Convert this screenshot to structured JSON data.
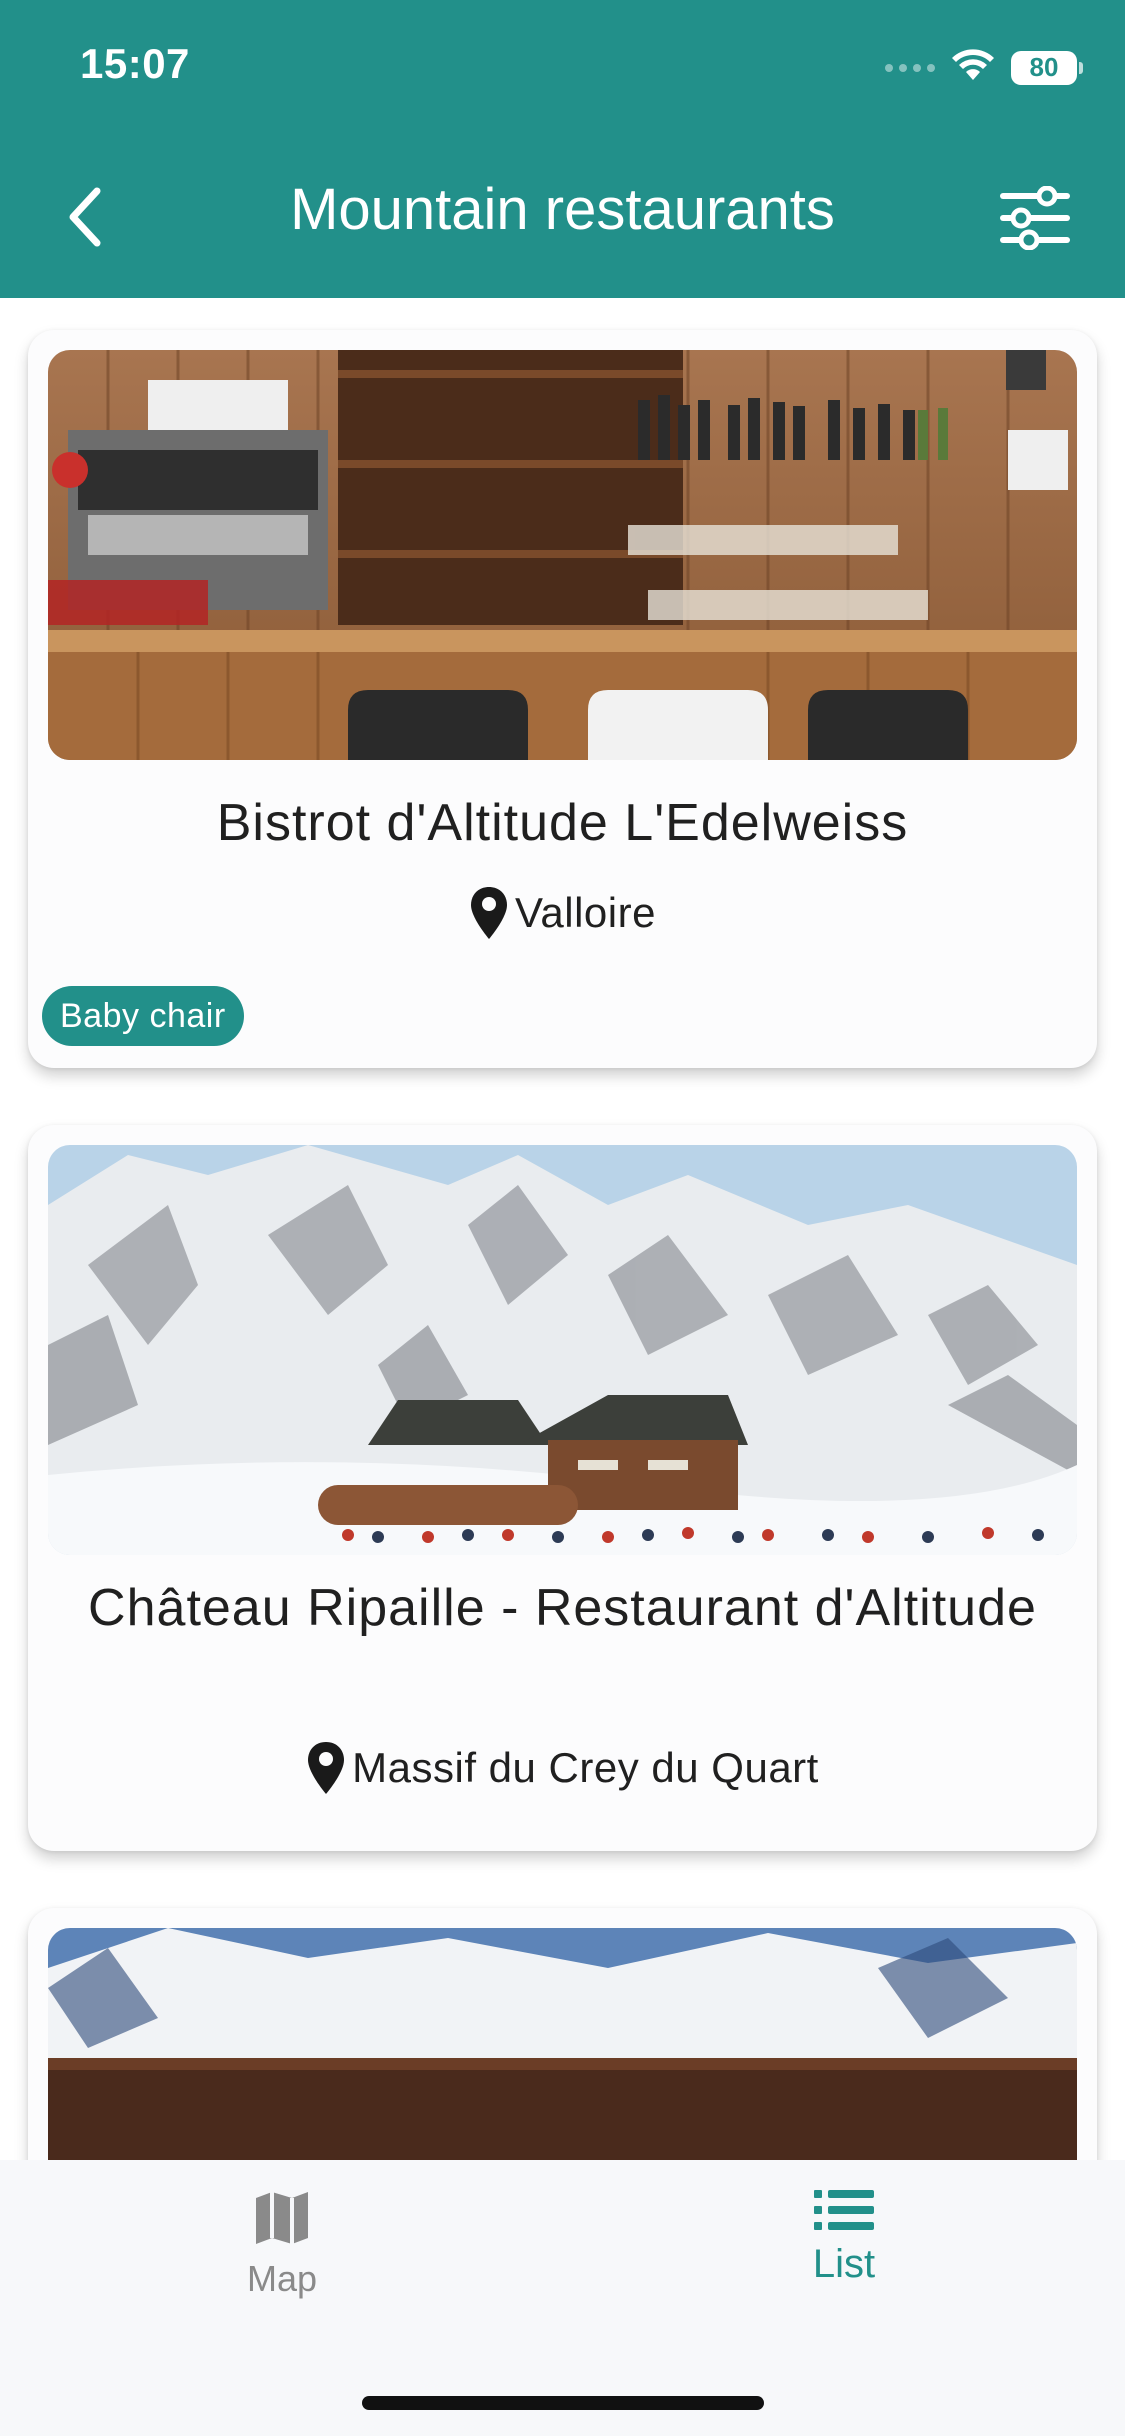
{
  "status_bar": {
    "time": "15:07",
    "battery": "80"
  },
  "header": {
    "title": "Mountain restaurants",
    "back_icon": "chevron-left-icon",
    "filter_icon": "sliders-icon"
  },
  "restaurants": [
    {
      "name": "Bistrot d'Altitude L'Edelweiss",
      "location": "Valloire",
      "badge": "Baby chair"
    },
    {
      "name": "Château Ripaille - Restaurant d'Altitude",
      "location": "Massif du Crey du Quart"
    }
  ],
  "bottom_nav": {
    "map_label": "Map",
    "list_label": "List",
    "active": "List"
  },
  "colors": {
    "primary": "#22908a",
    "text": "#202020",
    "inactive": "#8a8a8a"
  }
}
